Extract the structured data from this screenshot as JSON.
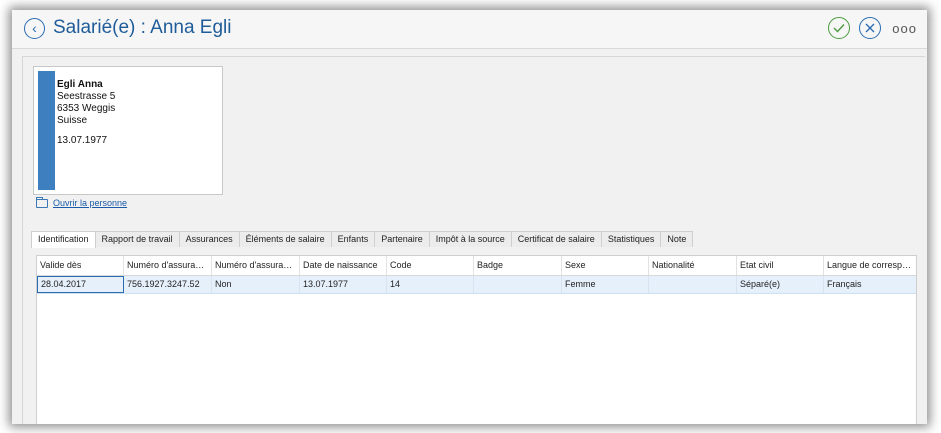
{
  "window": {
    "title": "Salarié(e) : Anna Egli",
    "back_symbol": "‹",
    "more_symbol": "ooo"
  },
  "person_card": {
    "name": "Egli Anna",
    "street": "Seestrasse 5",
    "city": "6353 Weggis",
    "country": "Suisse",
    "birthdate": "13.07.1977",
    "accent_color": "#3d7fbf"
  },
  "open_person_link": "Ouvrir la personne",
  "tabs": [
    {
      "label": "Identification",
      "active": true
    },
    {
      "label": "Rapport de travail"
    },
    {
      "label": "Assurances"
    },
    {
      "label": "Éléments de salaire"
    },
    {
      "label": "Enfants"
    },
    {
      "label": "Partenaire"
    },
    {
      "label": "Impôt à la source"
    },
    {
      "label": "Certificat de salaire"
    },
    {
      "label": "Statistiques"
    },
    {
      "label": "Note"
    }
  ],
  "grid": {
    "columns": [
      "Valide dès",
      "Numéro d'assuranc...",
      "Numéro d'assuranc...",
      "Date de naissance",
      "Code",
      "Badge",
      "Sexe",
      "Nationalité",
      "Etat civil",
      "Langue de correspon..."
    ],
    "rows": [
      [
        "28.04.2017",
        "756.1927.3247.52",
        "Non",
        "13.07.1977",
        "14",
        "",
        "Femme",
        "",
        "Séparé(e)",
        "Français"
      ]
    ]
  }
}
